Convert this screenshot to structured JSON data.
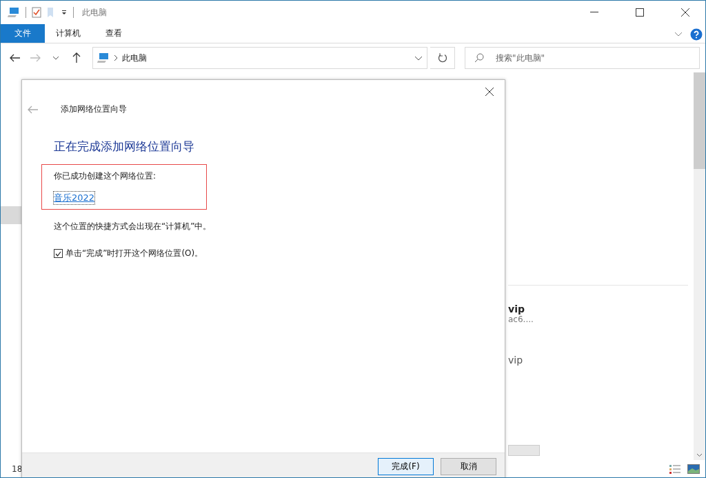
{
  "window": {
    "title": "此电脑"
  },
  "ribbon_tabs": [
    {
      "label": "文件",
      "selected": true
    },
    {
      "label": "计算机",
      "selected": false
    },
    {
      "label": "查看",
      "selected": false
    }
  ],
  "address_bar": {
    "path": "此电脑"
  },
  "search": {
    "placeholder": "搜索\"此电脑\""
  },
  "content": {
    "items": [
      {
        "kind": "heading",
        "name": "vip",
        "detail": "ac6...."
      },
      {
        "kind": "plain",
        "name": "vip"
      }
    ]
  },
  "status_bar": {
    "count": "18"
  },
  "dialog": {
    "title": "添加网络位置向导",
    "heading": "正在完成添加网络位置向导",
    "message": "你已成功创建这个网络位置:",
    "location_link": "音乐2022",
    "note": "这个位置的快捷方式会出现在“计算机”中。",
    "open_checkbox": {
      "label": "单击“完成”时打开这个网络位置(O)。",
      "checked": true
    },
    "buttons": [
      {
        "label": "完成(F)",
        "kind": "default"
      },
      {
        "label": "取消",
        "kind": "normal"
      }
    ]
  }
}
